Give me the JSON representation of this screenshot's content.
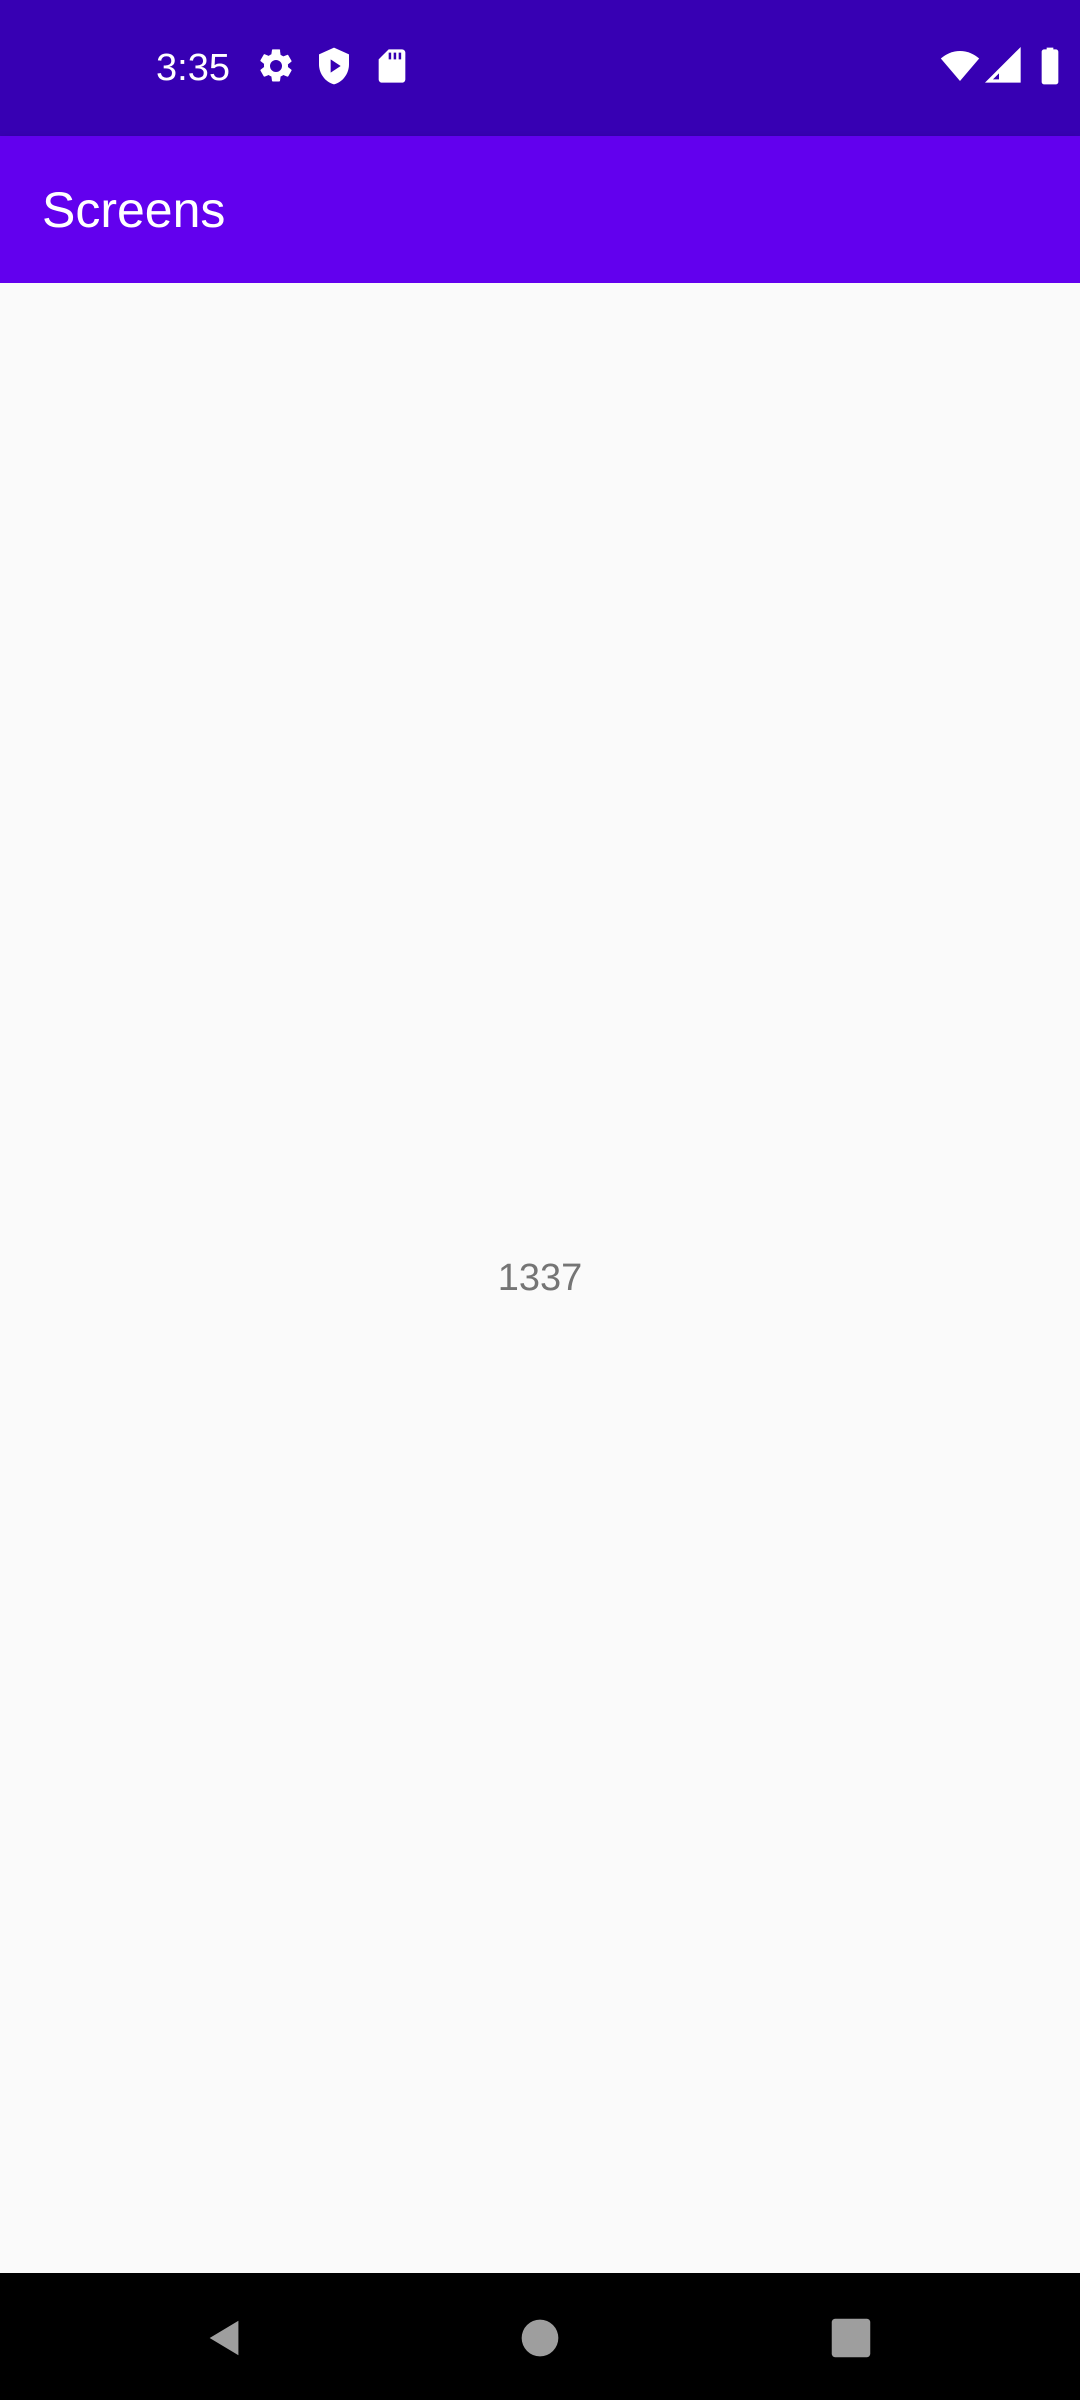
{
  "status_bar": {
    "time": "3:35",
    "left_icons": [
      "gear-icon",
      "shield-play-icon",
      "sd-card-icon"
    ],
    "right_icons": [
      "wifi-icon",
      "cell-signal-icon",
      "battery-icon"
    ],
    "background_color": "#3700b3"
  },
  "app_bar": {
    "title": "Screens",
    "background_color": "#6200ee"
  },
  "content": {
    "value_text": "1337",
    "background_color": "#fafafa"
  },
  "nav_bar": {
    "buttons": [
      "back-icon",
      "home-icon",
      "recents-icon"
    ],
    "background_color": "#000000"
  }
}
